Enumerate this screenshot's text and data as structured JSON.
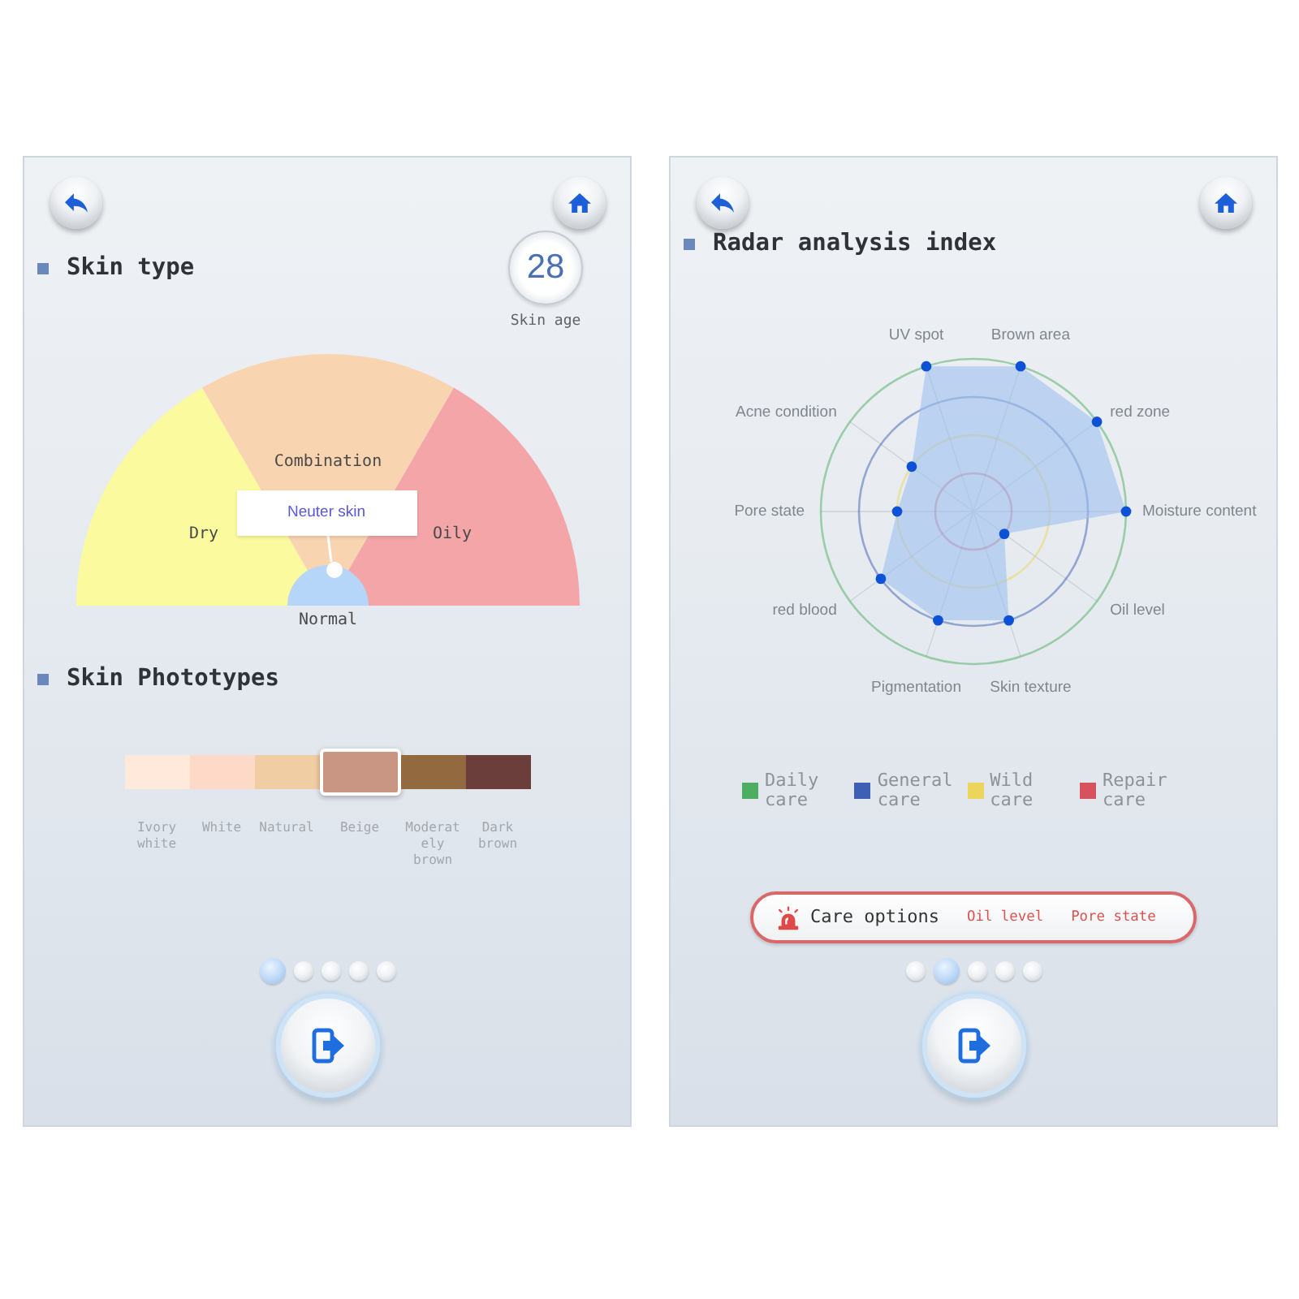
{
  "skin_type_screen": {
    "title": "Skin type",
    "skin_age": {
      "value": "28",
      "label": "Skin age"
    },
    "gauge": {
      "segments": [
        {
          "label": "Dry",
          "kind": "sector",
          "color": "#fbfa9e"
        },
        {
          "label": "Combination",
          "kind": "sector",
          "color": "#f8d4b1"
        },
        {
          "label": "Oily",
          "kind": "sector",
          "color": "#f4a5a7"
        },
        {
          "label": "Normal",
          "kind": "hub",
          "color": "#b6d6f9"
        }
      ],
      "result": "Neuter skin"
    },
    "phototypes_title": "Skin Phototypes",
    "phototypes": [
      {
        "label": "Ivory white",
        "color": "#fee9da",
        "selected": false
      },
      {
        "label": "White",
        "color": "#fddac7",
        "selected": false
      },
      {
        "label": "Natural",
        "color": "#f0cda2",
        "selected": false
      },
      {
        "label": "Beige",
        "color": "#c99683",
        "selected": true
      },
      {
        "label": "Moderately brown",
        "color": "#936a40",
        "selected": false
      },
      {
        "label": "Dark brown",
        "color": "#6b3d3b",
        "selected": false
      }
    ],
    "pages": [
      {
        "selected": true
      },
      {
        "selected": false
      },
      {
        "selected": false
      },
      {
        "selected": false
      },
      {
        "selected": false
      }
    ]
  },
  "radar_screen": {
    "title": "Radar analysis index",
    "radar": {
      "axis_rows": [
        {
          "left": "UV spot",
          "right": "Brown area"
        },
        {
          "left": "Acne condition",
          "right": "red zone"
        },
        {
          "left": "Pore state",
          "right": "Moisture content"
        },
        {
          "left": "red blood",
          "right": "Oil level"
        },
        {
          "left": "Pigmentation",
          "right": "Skin texture"
        }
      ]
    },
    "legend": [
      {
        "label": "Daily care",
        "color": "#4cae5e"
      },
      {
        "label": "General care",
        "color": "#3d5fb4"
      },
      {
        "label": "Wild care",
        "color": "#ecd55c"
      },
      {
        "label": "Repair care",
        "color": "#d8525e"
      }
    ],
    "care_options": {
      "label": "Care options",
      "items": [
        "Oil level",
        "Pore state"
      ]
    },
    "pages": [
      {
        "selected": false
      },
      {
        "selected": true
      },
      {
        "selected": false
      },
      {
        "selected": false
      },
      {
        "selected": false
      }
    ]
  }
}
